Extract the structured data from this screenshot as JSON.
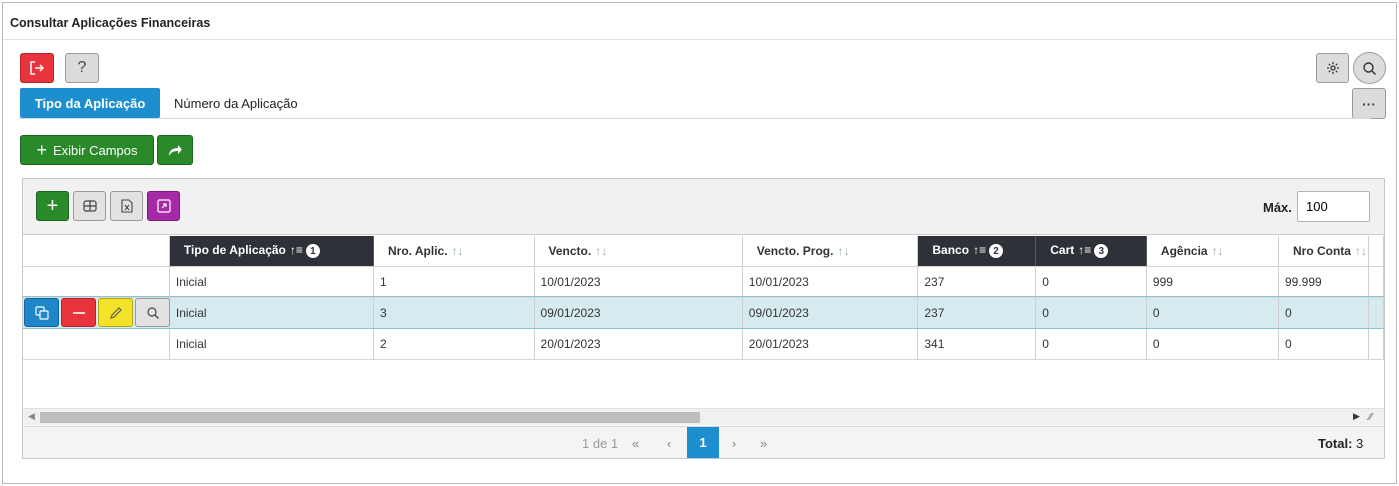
{
  "window": {
    "title": "Consultar Aplicações Financeiras"
  },
  "toolbar": {
    "exit_icon": "exit-icon",
    "help_label": "?",
    "settings_icon": "gear-icon",
    "search_icon": "search-icon",
    "more_label": "···"
  },
  "tabs": [
    {
      "label": "Tipo da Aplicação",
      "active": true
    },
    {
      "label": "Número da Aplicação",
      "active": false
    }
  ],
  "actions": {
    "show_fields_label": "Exibir Campos",
    "share_icon": "share-arrow-icon"
  },
  "grid": {
    "max_label": "Máx.",
    "max_value": "100",
    "columns": [
      {
        "label": "Tipo de Aplicação",
        "sorted": true,
        "order": "1"
      },
      {
        "label": "Nro. Aplic.",
        "sorted": false,
        "order": ""
      },
      {
        "label": "Vencto.",
        "sorted": false,
        "order": ""
      },
      {
        "label": "Vencto. Prog.",
        "sorted": false,
        "order": ""
      },
      {
        "label": "Banco",
        "sorted": true,
        "order": "2"
      },
      {
        "label": "Cart",
        "sorted": true,
        "order": "3"
      },
      {
        "label": "Agência",
        "sorted": false,
        "order": ""
      },
      {
        "label": "Nro Conta",
        "sorted": false,
        "order": ""
      }
    ],
    "rows": [
      [
        "Inicial",
        "1",
        "10/01/2023",
        "10/01/2023",
        "237",
        "0",
        "999",
        "99.999"
      ],
      [
        "Inicial",
        "3",
        "09/01/2023",
        "09/01/2023",
        "237",
        "0",
        "0",
        "0"
      ],
      [
        "Inicial",
        "2",
        "20/01/2023",
        "20/01/2023",
        "341",
        "0",
        "0",
        "0"
      ]
    ],
    "selected_row": 1
  },
  "pager": {
    "info": "1 de 1",
    "first": "«",
    "prev": "‹",
    "current": "1",
    "next": "›",
    "last": "»",
    "total_label": "Total:",
    "total_value": "3"
  },
  "colors": {
    "primary_blue": "#1d8fcf",
    "green": "#2a8a2a",
    "red": "#e8343c",
    "purple": "#a52aa5",
    "yellow": "#f2e22a",
    "header_dark": "#2e3238",
    "selected_row": "#d6ebf0"
  }
}
